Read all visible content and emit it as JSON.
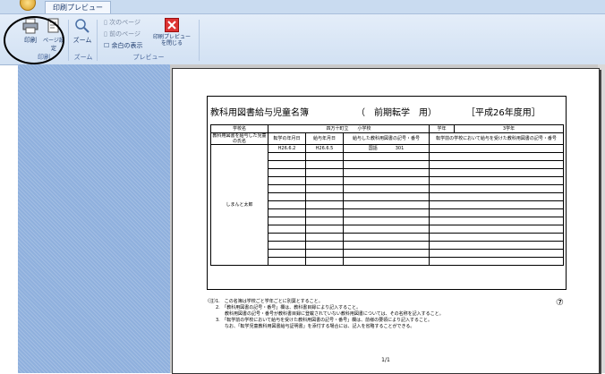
{
  "window": {
    "tab_label": "印刷プレビュー"
  },
  "ribbon": {
    "print_label": "印刷",
    "page_setup_label": "ページ設定",
    "zoom_label": "ズーム",
    "next_page_label": "次のページ",
    "prev_page_label": "前のページ",
    "show_margins_label": "余白の表示",
    "close_preview_label": "印刷プレビューを閉じる",
    "group_print": "印刷",
    "group_zoom": "ズーム",
    "group_preview": "プレビュー"
  },
  "document": {
    "title": "教科用図書給与児童名簿",
    "subtitle": "（　前期転学　用）",
    "year": "［平成26年度用］",
    "school_label": "学校名",
    "school_name": "四万十町立　　小学校",
    "grade_label": "学年",
    "grade_value": "3学年",
    "col_name": "教科用図書を給与した児童の氏名",
    "col_transfer_date": "転学の年月日",
    "col_supply_date": "給与年月日",
    "col_code": "給与した教科用図書の記号・番号",
    "col_prev_school": "転学前の学校において給与を受けた教科用図書の記号・番号",
    "row_transfer_date": "H26.6.2",
    "row_supply_date": "H26.6.5",
    "row_subject": "国語",
    "row_code": "301",
    "student_name": "しまんと太郎",
    "notes_mark": "（注）",
    "notes": [
      "1.　この名簿は学校ごと学年ごとに別葉とすること。",
      "2.　「教科用図書の記号・番号」欄は、教科書目録により記入すること。",
      "　　教科用図書の記号・番号が教科書目録に登載されていない教科用図書については、その名称を記入すること。",
      "3.　「転学前の学校において給与を受けた教科用図書の記号・番号」欄は、前様の要領により記入すること。",
      "　　なお、「転学児童教科用図書給与証明書」を添付する場合には、記入を省略することができる。"
    ],
    "circle_number": "⑦",
    "page_number": "1/1"
  }
}
